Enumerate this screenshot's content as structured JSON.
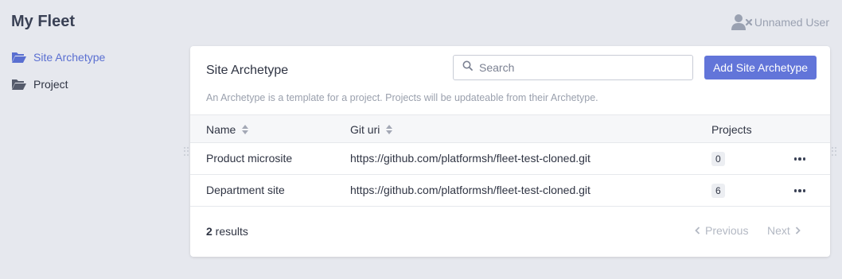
{
  "app": {
    "title": "My Fleet",
    "user_name": "Unnamed User"
  },
  "sidebar": {
    "items": [
      {
        "label": "Site Archetype",
        "icon": "folder-open-icon",
        "active": true
      },
      {
        "label": "Project",
        "icon": "folder-open-icon",
        "active": false
      }
    ]
  },
  "card": {
    "title": "Site Archetype",
    "search_placeholder": "Search",
    "add_button": "Add Site Archetype",
    "description": "An Archetype is a template for a project. Projects will be updateable from their Archetype."
  },
  "table": {
    "columns": {
      "name": "Name",
      "git_uri": "Git uri",
      "projects": "Projects"
    },
    "rows": [
      {
        "name": "Product microsite",
        "git_uri": "https://github.com/platformsh/fleet-test-cloned.git",
        "projects": "0"
      },
      {
        "name": "Department site",
        "git_uri": "https://github.com/platformsh/fleet-test-cloned.git",
        "projects": "6"
      }
    ]
  },
  "footer": {
    "result_count": "2",
    "result_suffix": " results",
    "previous": "Previous",
    "next": "Next"
  },
  "colors": {
    "accent": "#6275d9",
    "active_link": "#5a6fd1",
    "background": "#e6e8ee"
  }
}
